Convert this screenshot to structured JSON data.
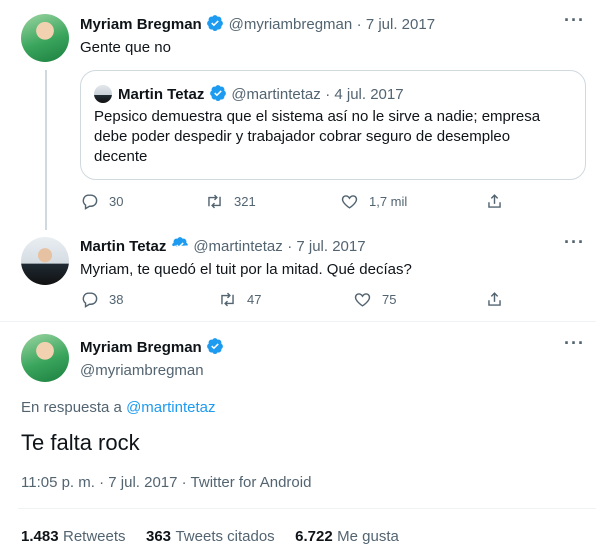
{
  "tweet1": {
    "name": "Myriam Bregman",
    "handle": "@myriambregman",
    "date": "· 7 jul. 2017",
    "text": "Gente que no",
    "quote": {
      "name": "Martin Tetaz",
      "handle": "@martintetaz",
      "date": "· 4 jul. 2017",
      "text_lines": [
        "Pepsico demuestra que el sistema así no le sirve a nadie; empresa",
        "debe poder despedir y trabajador cobrar seguro de desempleo",
        "decente"
      ]
    },
    "replies": "30",
    "retweets": "321",
    "likes": "1,7 mil"
  },
  "tweet2": {
    "name": "Martin Tetaz",
    "handle": "@martintetaz",
    "date": "· 7 jul. 2017",
    "text": "Myriam, te quedó el tuit por la mitad. Qué decías?",
    "replies": "38",
    "retweets": "47",
    "likes": "75"
  },
  "main": {
    "name": "Myriam Bregman",
    "handle": "@myriambregman",
    "reply_prefix": "En respuesta a",
    "reply_to": "@martintetaz",
    "text": "Te falta rock",
    "meta": "11:05 p. m. · 7 jul. 2017 · Twitter for Android",
    "stats": {
      "retweets_count": "1.483",
      "retweets_label": "Retweets",
      "quotes_count": "363",
      "quotes_label": "Tweets citados",
      "likes_count": "6.722",
      "likes_label": "Me gusta"
    }
  },
  "colors": {
    "accent": "#1d9bf0",
    "muted": "#536471",
    "border": "#cfd9de"
  },
  "icons": [
    "verified-badge-icon",
    "more-options-icon",
    "reply-icon",
    "retweet-icon",
    "like-icon",
    "share-icon"
  ]
}
